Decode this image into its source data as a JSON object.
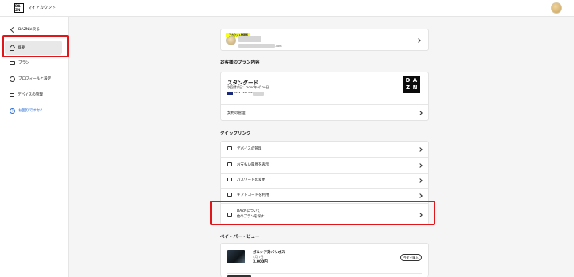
{
  "header": {
    "logo_letters": [
      "DA",
      "ZN"
    ],
    "title": "マイアカウント"
  },
  "sidebar": {
    "back_label": "DAZNに戻る",
    "items": [
      {
        "label": "概要",
        "icon": "home-icon"
      },
      {
        "label": "プラン",
        "icon": "card-icon"
      },
      {
        "label": "プロフィールと設定",
        "icon": "person-icon"
      },
      {
        "label": "デバイスの管理",
        "icon": "devices-icon"
      }
    ],
    "help_label": "お困りですか？",
    "help_color": "#2d6fd6"
  },
  "account": {
    "badge": "アカウント管理者",
    "domain": ".com"
  },
  "plan_section": {
    "title": "お客様のプラン内容",
    "plan_name": "スタンダード",
    "next_billing": "次回請求日： 2000年0月20日",
    "card_number": "•••• •••• ••••",
    "dazn_letters": [
      "D",
      "A",
      "Z",
      "N"
    ],
    "contract_label": "契約の管理"
  },
  "quick_links": {
    "title": "クイックリンク",
    "items": [
      {
        "label": "デバイスの管理",
        "icon": "devices-icon"
      },
      {
        "label": "お支払い履歴を表示",
        "icon": "receipt-icon"
      },
      {
        "label": "パスワードの変更",
        "icon": "lock-icon"
      },
      {
        "label": "ギフトコードを利用",
        "icon": "gift-icon"
      }
    ],
    "dazn_row": {
      "line1": "DAZNについて",
      "line2": "他のプランを探す",
      "icon": "tv-icon"
    }
  },
  "ppv": {
    "title": "ペイ・パー・ビュー",
    "event_title": "ガルシア対バリオス",
    "event_date": "4月 7日",
    "price": "3,000円",
    "buy_label": "今すぐ購入"
  },
  "colors": {
    "highlight": "#e0161b",
    "badge_yellow": "#f7ff1a",
    "background": "#f5f5f5"
  }
}
